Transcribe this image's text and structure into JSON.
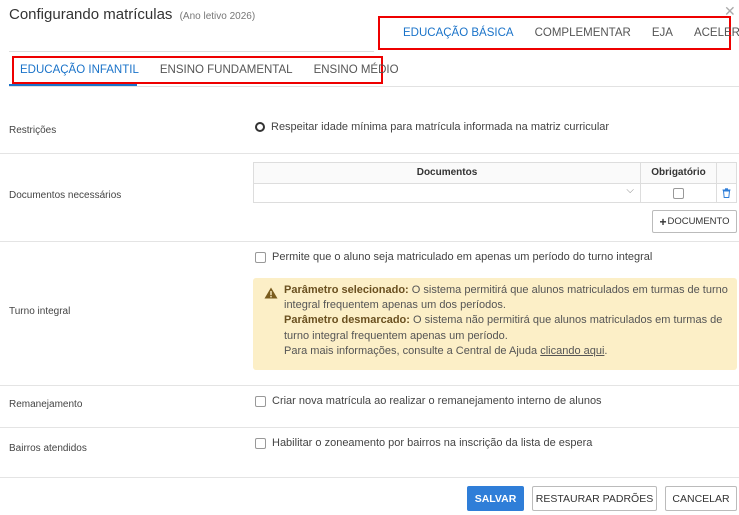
{
  "header": {
    "title": "Configurando matrículas",
    "subtitle": "(Ano letivo 2026)",
    "close_icon": "close-icon"
  },
  "top_tabs": [
    {
      "label": "EDUCAÇÃO BÁSICA",
      "active": true
    },
    {
      "label": "COMPLEMENTAR",
      "active": false
    },
    {
      "label": "EJA",
      "active": false
    },
    {
      "label": "ACELERAÇÃO",
      "active": false
    }
  ],
  "sub_tabs": [
    {
      "label": "EDUCAÇÃO INFANTIL",
      "active": true
    },
    {
      "label": "ENSINO FUNDAMENTAL",
      "active": false
    },
    {
      "label": "ENSINO MÉDIO",
      "active": false
    }
  ],
  "sections": {
    "restricoes": {
      "label": "Restrições",
      "option": "Respeitar idade mínima para matrícula informada na matriz curricular"
    },
    "documentos": {
      "label": "Documentos necessários",
      "col_documentos": "Documentos",
      "col_obrigatorio": "Obrigatório",
      "row_value": "",
      "add_button": "DOCUMENTO"
    },
    "turno": {
      "label": "Turno integral",
      "option": "Permite que o aluno seja matriculado em apenas um período do turno integral",
      "alert": {
        "selected_title": "Parâmetro selecionado:",
        "selected_text": "O sistema permitirá que alunos matriculados em turmas de turno integral frequentem apenas um dos períodos.",
        "unselected_title": "Parâmetro desmarcado:",
        "unselected_text": "O sistema não permitirá que alunos matriculados em turmas de turno integral frequentem apenas um período.",
        "help_text": "Para mais informações, consulte a Central de Ajuda",
        "help_link": "clicando aqui",
        "help_end": "."
      }
    },
    "remanejamento": {
      "label": "Remanejamento",
      "option": "Criar nova matrícula ao realizar o remanejamento interno de alunos"
    },
    "bairros": {
      "label": "Bairros atendidos",
      "option": "Habilitar o zoneamento por bairros na inscrição da lista de espera"
    }
  },
  "footer": {
    "save": "SALVAR",
    "restore": "RESTAURAR PADRÕES",
    "cancel": "CANCELAR"
  },
  "colors": {
    "accent": "#1a73c9",
    "primary_button": "#2f7ed8",
    "highlight_border": "#ee0000",
    "alert_bg": "#fcefc7"
  }
}
